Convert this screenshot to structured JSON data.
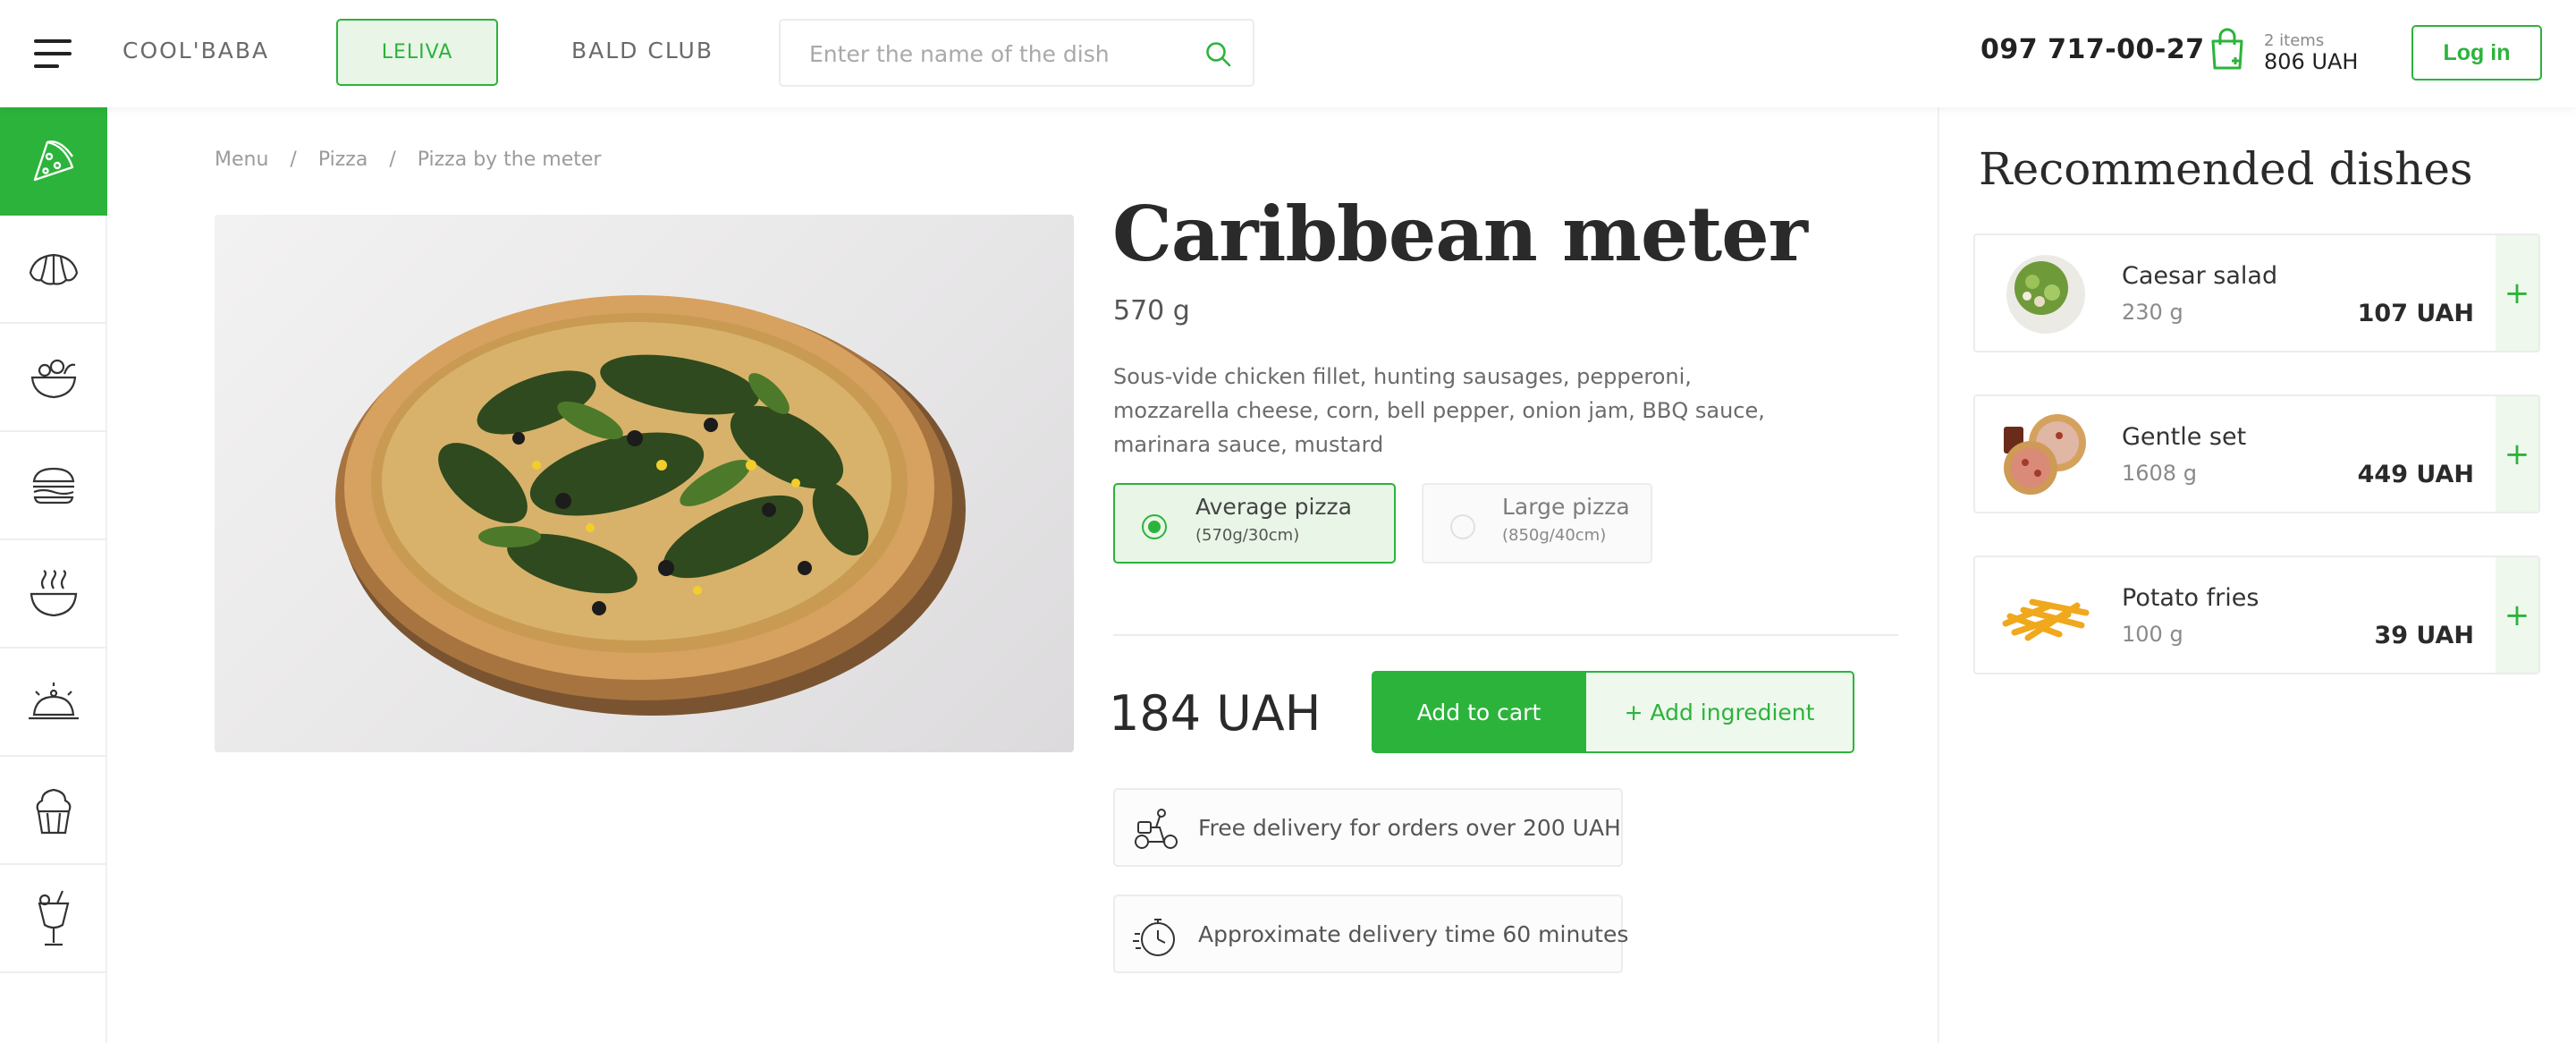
{
  "header": {
    "brands": [
      "COOL'BABA",
      "LELIVA",
      "BALD CLUB"
    ],
    "active_brand": "LELIVA",
    "search_placeholder": "Enter the name of the dish",
    "phone": "097 717-00-27",
    "cart": {
      "count": "2 items",
      "total": "806 UAH"
    },
    "login_label": "Log in"
  },
  "categories": [
    {
      "icon": "pizza-icon",
      "active": true
    },
    {
      "icon": "croissant-icon",
      "active": false
    },
    {
      "icon": "salad-icon",
      "active": false
    },
    {
      "icon": "burger-icon",
      "active": false
    },
    {
      "icon": "soup-icon",
      "active": false
    },
    {
      "icon": "hot-dish-icon",
      "active": false
    },
    {
      "icon": "cupcake-icon",
      "active": false
    },
    {
      "icon": "cocktail-icon",
      "active": false
    }
  ],
  "breadcrumb": [
    "Menu",
    "Pizza",
    "Pizza by the meter"
  ],
  "product": {
    "title": "Caribbean meter",
    "weight": "570 g",
    "description": "Sous-vide chicken fillet, hunting sausages, pepperoni, mozzarella cheese, corn, bell pepper, onion jam, BBQ sauce, marinara sauce, mustard",
    "sizes": [
      {
        "name": "Average pizza",
        "detail": "(570g/30cm)",
        "selected": true
      },
      {
        "name": "Large pizza",
        "detail": "(850g/40cm)",
        "selected": false
      }
    ],
    "price": "184 UAH",
    "add_to_cart": "Add to cart",
    "add_ingredient": "+ Add ingredient",
    "info": [
      {
        "icon": "delivery-scooter-icon",
        "text": "Free delivery for orders over 200 UAH"
      },
      {
        "icon": "stopwatch-icon",
        "text": "Approximate delivery time 60 minutes"
      }
    ]
  },
  "recommended": {
    "title": "Recommended dishes",
    "items": [
      {
        "name": "Caesar salad",
        "weight": "230 g",
        "price": "107 UAH"
      },
      {
        "name": "Gentle set",
        "weight": "1608 g",
        "price": "449 UAH"
      },
      {
        "name": "Potato fries",
        "weight": "100 g",
        "price": "39 UAH"
      }
    ],
    "add_symbol": "+"
  },
  "colors": {
    "accent": "#2cb33b",
    "accent_light": "#e9f6e7",
    "text": "#2a2a2a"
  }
}
